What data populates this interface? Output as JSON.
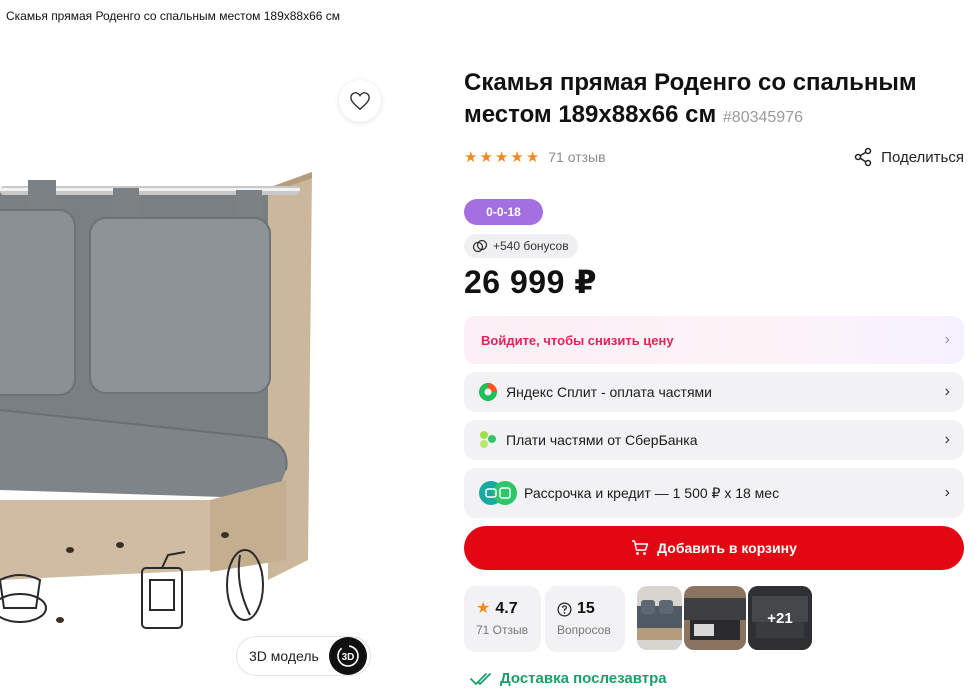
{
  "breadcrumb_title": "Скамья прямая Роденго со спальным местом 189x88x66 см",
  "product": {
    "title": "Скамья прямая Роденго со спальным местом 189x88x66 см",
    "article": "#80345976",
    "rating_stars": 5,
    "reviews_text": "71 отзыв",
    "share_label": "Поделиться",
    "age_badge": "0-0-18",
    "bonus_text": "+540 бонусов",
    "price": "26 999 ₽"
  },
  "promos": {
    "login": "Войдите, чтобы снизить цену",
    "split": "Яндекс Сплит - оплата частями",
    "sber": "Плати частями от СберБанка",
    "credit": "Рассрочка и кредит — 1 500 ₽ x 18 мес"
  },
  "cart": {
    "add_label": "Добавить в корзину"
  },
  "stats": {
    "rating_value": "4.7",
    "rating_sub": "71 Отзыв",
    "questions_value": "15",
    "questions_sub": "Вопросов"
  },
  "thumbs": {
    "more_label": "+21"
  },
  "gallery": {
    "model_label": "3D модель"
  },
  "delivery": {
    "label": "Доставка послезавтра"
  },
  "colors": {
    "accent_red": "#e30613",
    "star_orange": "#f5891f",
    "age_purple": "#a46fe0",
    "delivery_green": "#1a9f6a",
    "promo_pink": "#e2245a"
  },
  "icons": [
    "heart-icon",
    "share-icon",
    "bonus-icon",
    "chevron-right-icon",
    "yandex-split-icon",
    "sber-icon",
    "credit-icon",
    "cart-icon",
    "star-icon",
    "question-icon",
    "3d-icon",
    "check-icon"
  ]
}
